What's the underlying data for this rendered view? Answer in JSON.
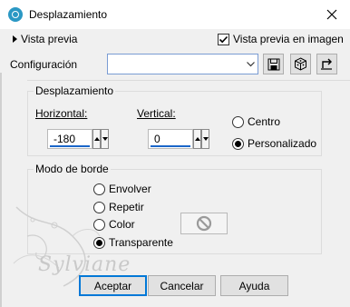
{
  "window": {
    "title": "Desplazamiento"
  },
  "preview": {
    "toggle_label": "Vista previa",
    "checkbox_label": "Vista previa en imagen",
    "checked": true
  },
  "config": {
    "label": "Configuración",
    "value": ""
  },
  "offset": {
    "title": "Desplazamiento",
    "horizontal_label": "Horizontal:",
    "horizontal_value": "-180",
    "vertical_label": "Vertical:",
    "vertical_value": "0",
    "options": [
      {
        "label": "Centro",
        "selected": false
      },
      {
        "label": "Personalizado",
        "selected": true
      }
    ]
  },
  "edge_mode": {
    "title": "Modo de borde",
    "options": [
      {
        "label": "Envolver",
        "selected": false
      },
      {
        "label": "Repetir",
        "selected": false
      },
      {
        "label": "Color",
        "selected": false
      },
      {
        "label": "Transparente",
        "selected": true
      }
    ]
  },
  "watermark": {
    "text": "Sylviane"
  },
  "buttons": {
    "accept": "Aceptar",
    "cancel": "Cancelar",
    "help": "Ayuda"
  },
  "colors": {
    "accent": "#1a66c9",
    "icon": "#2b98c4",
    "focus": "#0078d7"
  }
}
